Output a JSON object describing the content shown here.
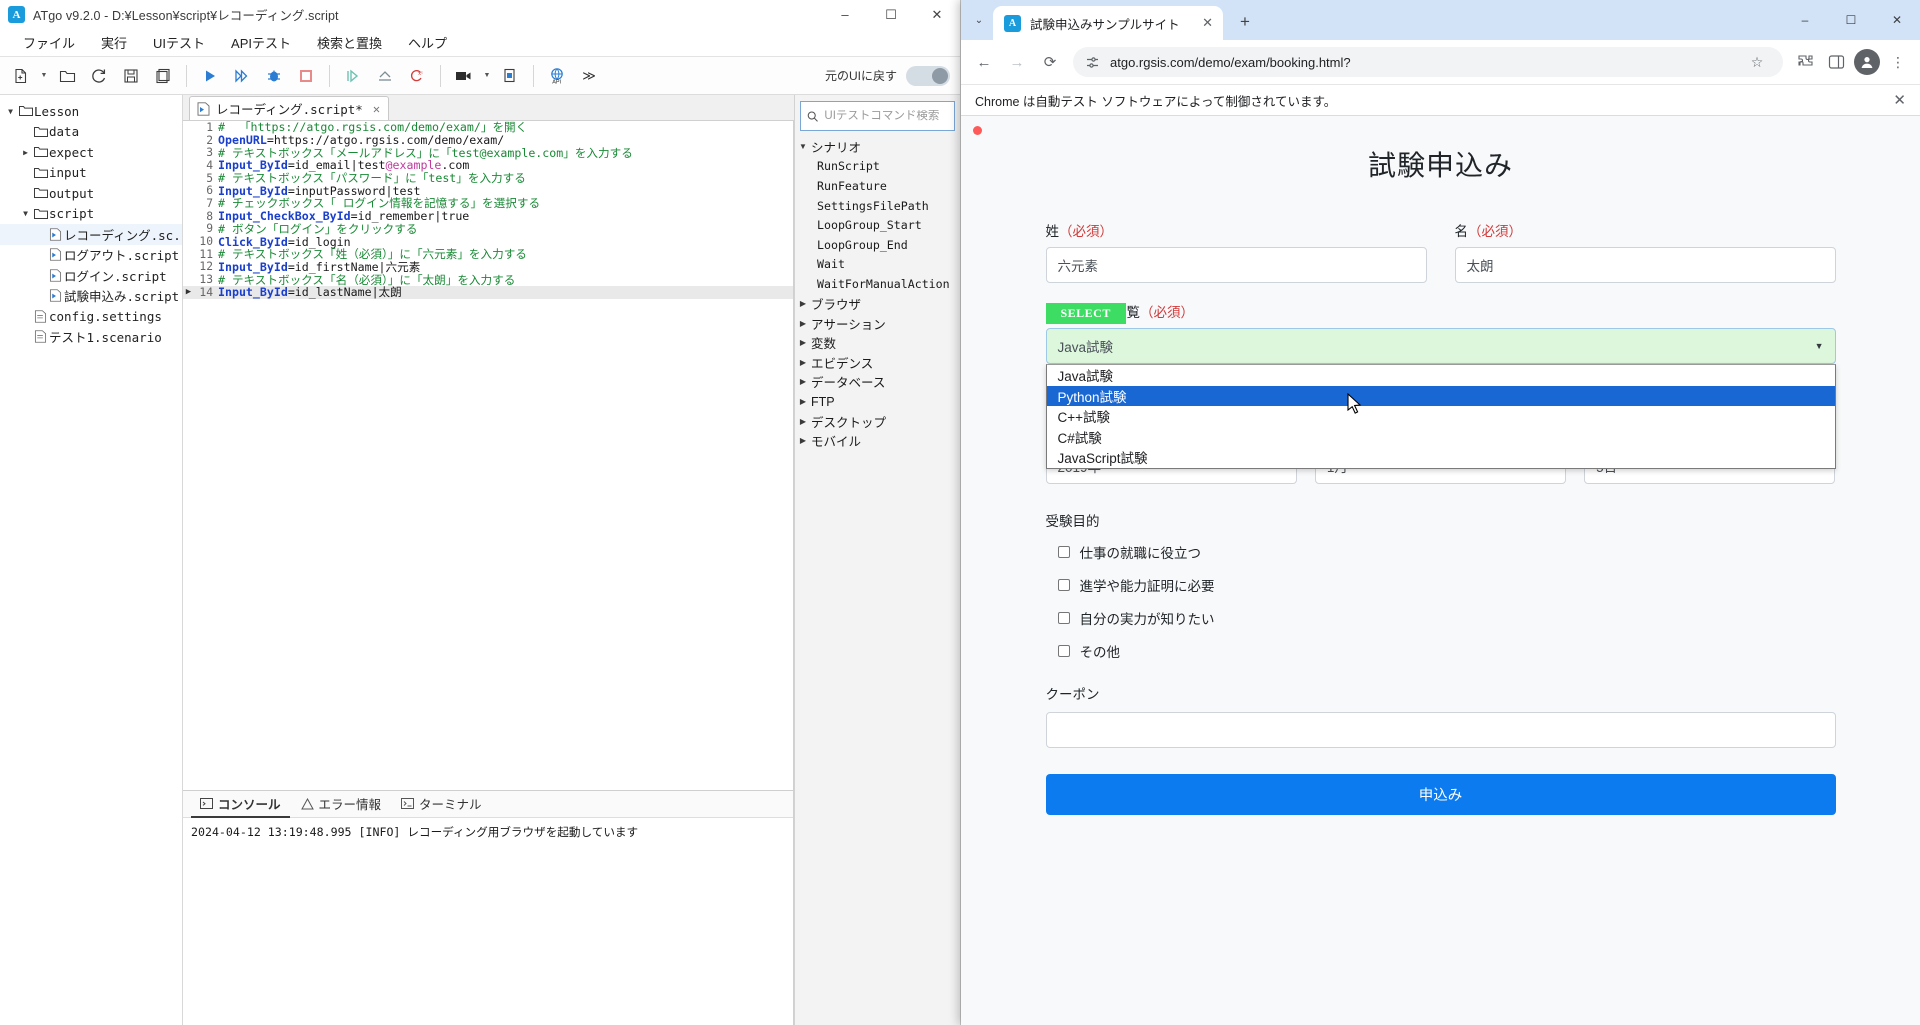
{
  "atgo": {
    "title": "ATgo v9.2.0 - D:¥Lesson¥script¥レコーディング.script",
    "logo_letter": "A",
    "window_buttons": {
      "minimize": "–",
      "maximize": "☐",
      "close": "✕"
    },
    "menu": [
      "ファイル",
      "実行",
      "UIテスト",
      "APIテスト",
      "検索と置換",
      "ヘルプ"
    ],
    "toolbar": {
      "restore_ui_label": "元のUIに戻す",
      "overflow_label": "≫",
      "items": [
        {
          "name": "new-file-icon",
          "glyph": "new"
        },
        {
          "name": "open-folder-icon",
          "glyph": "folder"
        },
        {
          "name": "reload-icon",
          "glyph": "reload"
        },
        {
          "name": "save-icon",
          "glyph": "save"
        },
        {
          "name": "save-as-icon",
          "glyph": "saveas"
        },
        {
          "name": "run-icon",
          "glyph": "play"
        },
        {
          "name": "step-run-icon",
          "glyph": "steps"
        },
        {
          "name": "debug-icon",
          "glyph": "bug"
        },
        {
          "name": "stop-icon",
          "glyph": "stop"
        },
        {
          "name": "continue-icon",
          "glyph": "play2"
        },
        {
          "name": "step-over-icon",
          "glyph": "over"
        },
        {
          "name": "clear-breakpoints-icon",
          "glyph": "xx"
        },
        {
          "name": "record-video-icon",
          "glyph": "camera"
        },
        {
          "name": "evidence-icon",
          "glyph": "doc"
        },
        {
          "name": "api-icon",
          "glyph": "api"
        }
      ]
    },
    "filetree": [
      {
        "level": 0,
        "arrow": "▼",
        "icon": "folder-open",
        "label": "Lesson",
        "selected": false
      },
      {
        "level": 1,
        "arrow": "",
        "icon": "folder",
        "label": "data",
        "selected": false
      },
      {
        "level": 1,
        "arrow": "▶",
        "icon": "folder",
        "label": "expect",
        "selected": false
      },
      {
        "level": 1,
        "arrow": "",
        "icon": "folder",
        "label": "input",
        "selected": false
      },
      {
        "level": 1,
        "arrow": "",
        "icon": "folder",
        "label": "output",
        "selected": false
      },
      {
        "level": 1,
        "arrow": "▼",
        "icon": "folder-open",
        "label": "script",
        "selected": false
      },
      {
        "level": 2,
        "arrow": "",
        "icon": "script",
        "label": "レコーディング.sc...",
        "selected": true
      },
      {
        "level": 2,
        "arrow": "",
        "icon": "script",
        "label": "ログアウト.script",
        "selected": false
      },
      {
        "level": 2,
        "arrow": "",
        "icon": "script",
        "label": "ログイン.script",
        "selected": false
      },
      {
        "level": 2,
        "arrow": "",
        "icon": "script",
        "label": "試験申込み.script",
        "selected": false
      },
      {
        "level": 1,
        "arrow": "",
        "icon": "settings",
        "label": "config.settings",
        "selected": false
      },
      {
        "level": 1,
        "arrow": "",
        "icon": "scenario",
        "label": "テスト1.scenario",
        "selected": false
      }
    ],
    "editor": {
      "tab_label": "レコーディング.script*",
      "tab_close": "✕",
      "lines": [
        {
          "n": "1",
          "marker": "",
          "current": false,
          "parts": [
            {
              "t": "cmt",
              "s": "#  「https://atgo.rgsis.com/demo/exam/」を開く"
            }
          ]
        },
        {
          "n": "2",
          "marker": "",
          "current": false,
          "parts": [
            {
              "t": "kw",
              "s": "OpenURL"
            },
            {
              "t": "plain",
              "s": "=https://atgo.rgsis.com/demo/exam/"
            }
          ]
        },
        {
          "n": "3",
          "marker": "",
          "current": false,
          "parts": [
            {
              "t": "cmt",
              "s": "# テキストボックス「メールアドレス」に「test@example.com」を入力する"
            }
          ]
        },
        {
          "n": "4",
          "marker": "",
          "current": false,
          "parts": [
            {
              "t": "kw",
              "s": "Input_ById"
            },
            {
              "t": "plain",
              "s": "=id_email|test"
            },
            {
              "t": "mail",
              "s": "@example"
            },
            {
              "t": "plain",
              "s": ".com"
            }
          ]
        },
        {
          "n": "5",
          "marker": "",
          "current": false,
          "parts": [
            {
              "t": "cmt",
              "s": "# テキストボックス「パスワード」に「test」を入力する"
            }
          ]
        },
        {
          "n": "6",
          "marker": "",
          "current": false,
          "parts": [
            {
              "t": "kw",
              "s": "Input_ById"
            },
            {
              "t": "plain",
              "s": "=inputPassword|test"
            }
          ]
        },
        {
          "n": "7",
          "marker": "",
          "current": false,
          "parts": [
            {
              "t": "cmt",
              "s": "# チェックボックス「 ログイン情報を記憶する」を選択する"
            }
          ]
        },
        {
          "n": "8",
          "marker": "",
          "current": false,
          "parts": [
            {
              "t": "kw",
              "s": "Input_CheckBox_ById"
            },
            {
              "t": "plain",
              "s": "=id_remember|true"
            }
          ]
        },
        {
          "n": "9",
          "marker": "",
          "current": false,
          "parts": [
            {
              "t": "cmt",
              "s": "# ボタン「ログイン」をクリックする"
            }
          ]
        },
        {
          "n": "10",
          "marker": "",
          "current": false,
          "parts": [
            {
              "t": "kw",
              "s": "Click_ById"
            },
            {
              "t": "plain",
              "s": "=id_login"
            }
          ]
        },
        {
          "n": "11",
          "marker": "",
          "current": false,
          "parts": [
            {
              "t": "cmt",
              "s": "# テキストボックス「姓（必須）」に「六元素」を入力する"
            }
          ]
        },
        {
          "n": "12",
          "marker": "",
          "current": false,
          "parts": [
            {
              "t": "kw",
              "s": "Input_ById"
            },
            {
              "t": "plain",
              "s": "=id_firstName|六元素"
            }
          ]
        },
        {
          "n": "13",
          "marker": "",
          "current": false,
          "parts": [
            {
              "t": "cmt",
              "s": "# テキストボックス「名（必須）」に「太朗」を入力する"
            }
          ]
        },
        {
          "n": "14",
          "marker": "▶",
          "current": true,
          "parts": [
            {
              "t": "kw",
              "s": "Input_ById"
            },
            {
              "t": "plain",
              "s": "=id_lastName|太朗"
            }
          ]
        }
      ]
    },
    "console": {
      "tabs": [
        {
          "label": "コンソール",
          "icon": "console-icon",
          "active": true
        },
        {
          "label": "エラー情報",
          "icon": "warning-icon",
          "active": false
        },
        {
          "label": "ターミナル",
          "icon": "terminal-icon",
          "active": false
        }
      ],
      "output": "2024-04-12 13:19:48.995 [INFO] レコーディング用ブラウザを起動しています"
    },
    "command_panel": {
      "search_placeholder": "UIテストコマンド検索",
      "search_value": "",
      "groups": [
        {
          "label": "シナリオ",
          "arrow": "▼",
          "children": [
            "RunScript",
            "RunFeature",
            "SettingsFilePath",
            "LoopGroup_Start",
            "LoopGroup_End",
            "Wait",
            "WaitForManualAction"
          ]
        },
        {
          "label": "ブラウザ",
          "arrow": "▶",
          "children": []
        },
        {
          "label": "アサーション",
          "arrow": "▶",
          "children": []
        },
        {
          "label": "変数",
          "arrow": "▶",
          "children": []
        },
        {
          "label": "エビデンス",
          "arrow": "▶",
          "children": []
        },
        {
          "label": "データベース",
          "arrow": "▶",
          "children": []
        },
        {
          "label": "FTP",
          "arrow": "▶",
          "children": []
        },
        {
          "label": "デスクトップ",
          "arrow": "▶",
          "children": []
        },
        {
          "label": "モバイル",
          "arrow": "▶",
          "children": []
        }
      ]
    }
  },
  "chrome": {
    "tab": {
      "title": "試験申込みサンプルサイト",
      "favicon_letter": "A",
      "close": "✕"
    },
    "new_tab_label": "+",
    "tab_search_label": "⌄",
    "window_buttons": {
      "minimize": "–",
      "maximize": "☐",
      "close": "✕"
    },
    "nav": {
      "back": "←",
      "forward": "→",
      "reload": "⟳"
    },
    "omnibox": {
      "url": "atgo.rgsis.com/demo/exam/booking.html?",
      "site_icon": "tune-icon"
    },
    "toolbar_icons": [
      {
        "name": "bookmark-star-icon",
        "glyph": "☆"
      },
      {
        "name": "extensions-icon",
        "glyph": "puzzle"
      },
      {
        "name": "side-panel-icon",
        "glyph": "panel"
      },
      {
        "name": "profile-avatar-icon",
        "glyph": "person"
      },
      {
        "name": "chrome-menu-icon",
        "glyph": "⋮"
      }
    ],
    "infobar": {
      "message": "Chrome は自動テスト ソフトウェアによって制御されています。",
      "close": "✕"
    }
  },
  "page": {
    "title": "試験申込み",
    "fields": {
      "lastname_label": "姓",
      "lastname_required": "（必須）",
      "lastname_value": "六元素",
      "firstname_label": "名",
      "firstname_required": "（必須）",
      "firstname_value": "太朗",
      "exam_label": "申込み試験一覧",
      "exam_required": "（必須）",
      "exam_value": "Java試験",
      "select_badge": "SELECT",
      "exam_options": [
        "Java試験",
        "Python試験",
        "C++試験",
        "C#試験",
        "JavaScript試験"
      ],
      "exam_highlighted_option": "Python試験",
      "year_value": "2019年",
      "month_value": "1月",
      "day_value": "5日",
      "purpose_label": "受験目的",
      "purpose_options": [
        {
          "label": "仕事の就職に役立つ",
          "checked": false
        },
        {
          "label": "進学や能力証明に必要",
          "checked": false
        },
        {
          "label": "自分の実力が知りたい",
          "checked": false
        },
        {
          "label": "その他",
          "checked": false
        }
      ],
      "coupon_label": "クーポン",
      "coupon_value": "",
      "submit_label": "申込み"
    },
    "colors": {
      "submit_bg": "#0d7bf0",
      "badge_bg": "#3ddc62",
      "option_selected_bg": "#1967d2",
      "highlight_field_bg": "#ddf7dd",
      "required_text": "#d03a3a"
    }
  }
}
